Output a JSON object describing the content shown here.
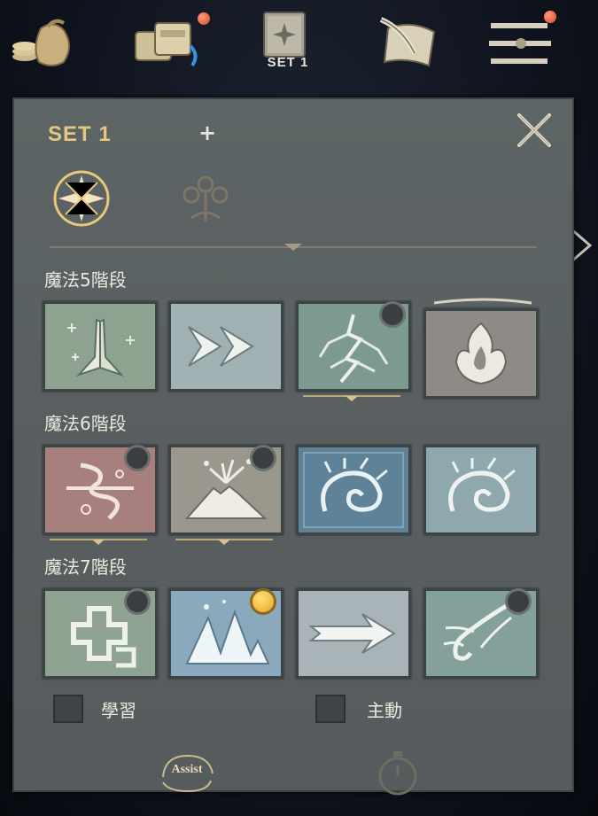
{
  "topbar": {
    "items": [
      {
        "name": "money-bag-icon"
      },
      {
        "name": "inventory-bags-icon"
      },
      {
        "name": "skill-book-icon",
        "label": "SET 1"
      },
      {
        "name": "scroll-quill-icon"
      },
      {
        "name": "menu-icon"
      }
    ]
  },
  "panel": {
    "title": "SET 1",
    "add_label": "+",
    "tabs": [
      {
        "name": "magic-tab-icon",
        "active": true
      },
      {
        "name": "tree-tab-icon",
        "active": false
      }
    ]
  },
  "sections": [
    {
      "title": "魔法5階段",
      "skills": [
        {
          "icon": "praying-hands-icon",
          "bg": "#8da38f",
          "dot": "none"
        },
        {
          "icon": "double-arrow-icon",
          "bg": "#9fb1b3",
          "dot": "none"
        },
        {
          "icon": "lightning-tree-icon",
          "bg": "#7d9a91",
          "dot": "empty"
        },
        {
          "icon": "flame-icon",
          "bg": "#8e8a86",
          "dot": "none"
        }
      ]
    },
    {
      "title": "魔法6階段",
      "skills": [
        {
          "icon": "thorny-rune-icon",
          "bg": "#a77f7c",
          "dot": "empty"
        },
        {
          "icon": "volcano-icon",
          "bg": "#9a978d",
          "dot": "empty"
        },
        {
          "icon": "ice-swirl-icon",
          "bg": "#5e8398",
          "dot": "none"
        },
        {
          "icon": "swirl-wave-icon",
          "bg": "#8fa8ae",
          "dot": "none"
        }
      ]
    },
    {
      "title": "魔法7階段",
      "skills": [
        {
          "icon": "cross-heal-icon",
          "bg": "#8ea391",
          "dot": "empty"
        },
        {
          "icon": "ice-peaks-icon",
          "bg": "#8aa9bd",
          "dot": "gold"
        },
        {
          "icon": "single-arrow-icon",
          "bg": "#a8b4b8",
          "dot": "none"
        },
        {
          "icon": "wind-gust-icon",
          "bg": "#83a09a",
          "dot": "empty"
        }
      ]
    }
  ],
  "footer": {
    "learn_label": "學習",
    "active_label": "主動",
    "assist_label": "Assist"
  },
  "colors": {
    "title_gold": "#e6c77d",
    "panel_bg": "#5b6162",
    "notif_red": "#d8492a"
  }
}
